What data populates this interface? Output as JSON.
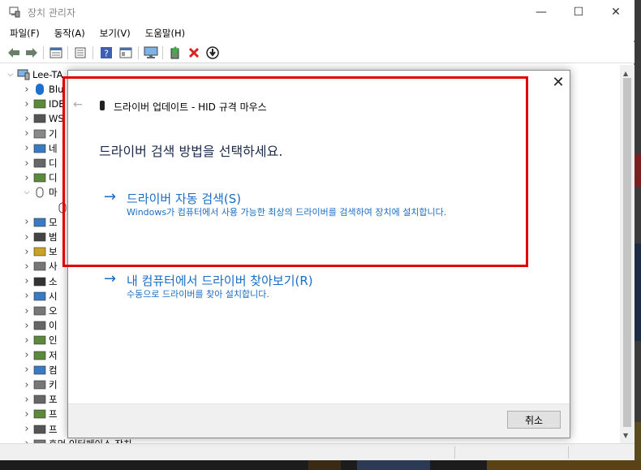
{
  "window": {
    "title": "장치 관리자",
    "controls": {
      "minimize": "—",
      "maximize": "☐",
      "close": "✕"
    }
  },
  "menu": [
    "파일(F)",
    "동작(A)",
    "보기(V)",
    "도움말(H)"
  ],
  "tree": {
    "root": "Lee-TA",
    "items": [
      {
        "text": "Blu",
        "icon": "bluetooth-icon",
        "expanded": false
      },
      {
        "text": "IDE",
        "icon": "ide-controller-icon",
        "expanded": false
      },
      {
        "text": "WS",
        "icon": "printer-icon",
        "expanded": false
      },
      {
        "text": "기",
        "icon": "unknown-device-icon",
        "expanded": false
      },
      {
        "text": "네",
        "icon": "network-adapter-icon",
        "expanded": false
      },
      {
        "text": "디",
        "icon": "disk-drive-icon",
        "expanded": false
      },
      {
        "text": "디",
        "icon": "display-adapter-icon",
        "expanded": false
      },
      {
        "text": "마",
        "icon": "mouse-icon",
        "expanded": true
      },
      {
        "text": "",
        "icon": "mouse-icon",
        "expanded": null
      },
      {
        "text": "모",
        "icon": "monitor-icon",
        "expanded": false
      },
      {
        "text": "범",
        "icon": "usb-icon",
        "expanded": false
      },
      {
        "text": "보",
        "icon": "security-device-icon",
        "expanded": false
      },
      {
        "text": "사",
        "icon": "audio-icon",
        "expanded": false
      },
      {
        "text": "소",
        "icon": "software-device-icon",
        "expanded": false
      },
      {
        "text": "시",
        "icon": "system-device-icon",
        "expanded": false
      },
      {
        "text": "오",
        "icon": "audio-io-icon",
        "expanded": false
      },
      {
        "text": "이",
        "icon": "portable-device-icon",
        "expanded": false
      },
      {
        "text": "인",
        "icon": "biometric-icon",
        "expanded": false
      },
      {
        "text": "저",
        "icon": "storage-controller-icon",
        "expanded": false
      },
      {
        "text": "컴",
        "icon": "computer-icon",
        "expanded": false
      },
      {
        "text": "키",
        "icon": "keyboard-icon",
        "expanded": false
      },
      {
        "text": "포",
        "icon": "port-icon",
        "expanded": false
      },
      {
        "text": "프",
        "icon": "processor-icon",
        "expanded": false
      },
      {
        "text": "프",
        "icon": "printer-icon",
        "expanded": false
      },
      {
        "text": "휴먼 인터페이스 장치",
        "icon": "hid-icon",
        "expanded": false
      }
    ]
  },
  "dialog": {
    "back": "←",
    "close": "✕",
    "header": "드라이버 업데이트 - HID 규격 마우스",
    "heading": "드라이버 검색 방법을 선택하세요.",
    "options": [
      {
        "label": "드라이버 자동 검색(S)",
        "description": "Windows가 컴퓨터에서 사용 가능한 최상의 드라이버를 검색하여 장치에 설치합니다."
      },
      {
        "label": "내 컴퓨터에서 드라이버 찾아보기(R)",
        "description": "수동으로 드라이버를 찾아 설치합니다."
      }
    ],
    "cancel": "취소"
  },
  "colors": {
    "link": "#1a6dc4",
    "annotation": "#e00000"
  }
}
